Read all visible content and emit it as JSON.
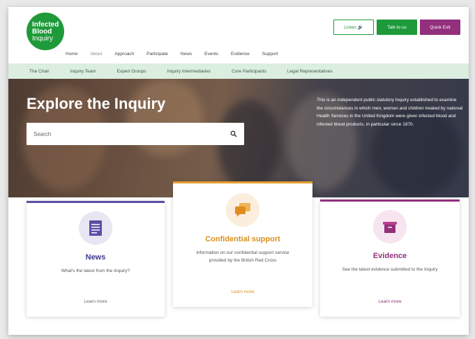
{
  "logo": {
    "line1": "Infected",
    "line2": "Blood",
    "line3": "Inquiry"
  },
  "top_buttons": {
    "listen": "Listen 🔊",
    "talk": "Talk to us",
    "exit": "Quick Exit"
  },
  "main_nav": [
    "Home",
    "About",
    "Approach",
    "Participate",
    "News",
    "Events",
    "Evidence",
    "Support"
  ],
  "sub_nav": [
    "The Chair",
    "Inquiry Team",
    "Expert Groups",
    "Inquiry Intermediaries",
    "Core Participants",
    "Legal Representatives"
  ],
  "hero": {
    "title": "Explore the Inquiry",
    "description": "This is an independent public statutory Inquiry established to examine the circumstances in which men, women and children treated by national Health Services in the United Kingdom were given infected blood and infected blood products, in particular since 1970.",
    "search_placeholder": "Search"
  },
  "cards": {
    "news": {
      "title": "News",
      "desc": "What's the latest from the Inquiry?",
      "link": "Learn more"
    },
    "support": {
      "title": "Confidential support",
      "desc": "Information on our confidential support service provided by the British Red Cross",
      "link": "Learn more"
    },
    "evidence": {
      "title": "Evidence",
      "desc": "See the latest evidence submitted to the Inquiry",
      "link": "Learn more"
    }
  },
  "colors": {
    "green": "#1f9a3a",
    "purple": "#93307d",
    "news_accent": "#5a4fa5",
    "support_accent": "#e59e2d"
  }
}
